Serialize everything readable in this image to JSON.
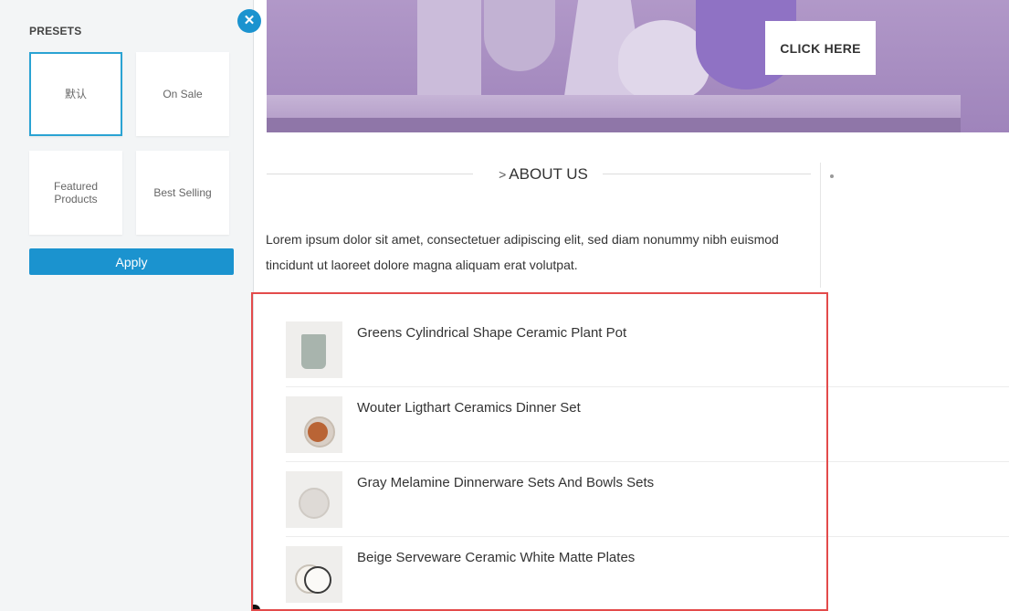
{
  "presets_panel": {
    "title": "PRESETS",
    "close_label": "✕",
    "presets": [
      {
        "label": "默认",
        "selected": true
      },
      {
        "label": "On Sale",
        "selected": false
      },
      {
        "label": "Featured Products",
        "selected": false
      },
      {
        "label": "Best Selling",
        "selected": false
      }
    ],
    "apply_label": "Apply",
    "accent_color": "#1b93cf"
  },
  "banner": {
    "cta_label": "CLICK HERE",
    "background_color": "#a68bc0"
  },
  "about": {
    "heading": "ABOUT US",
    "chevron": ">",
    "text": "Lorem ipsum dolor sit amet, consectetuer adipiscing elit, sed diam nonummy nibh euismod tincidunt ut laoreet dolore magna aliquam erat volutpat."
  },
  "products": [
    {
      "title": "Greens Cylindrical Shape Ceramic Plant Pot",
      "thumb_icon": "ceramic-pot-icon"
    },
    {
      "title": "Wouter Ligthart Ceramics Dinner Set",
      "thumb_icon": "dinner-set-icon"
    },
    {
      "title": "Gray Melamine Dinnerware Sets And Bowls Sets",
      "thumb_icon": "gray-plate-icon"
    },
    {
      "title": "Beige Serveware Ceramic White Matte Plates",
      "thumb_icon": "white-plates-icon"
    }
  ],
  "highlight_color": "#e34b4b"
}
